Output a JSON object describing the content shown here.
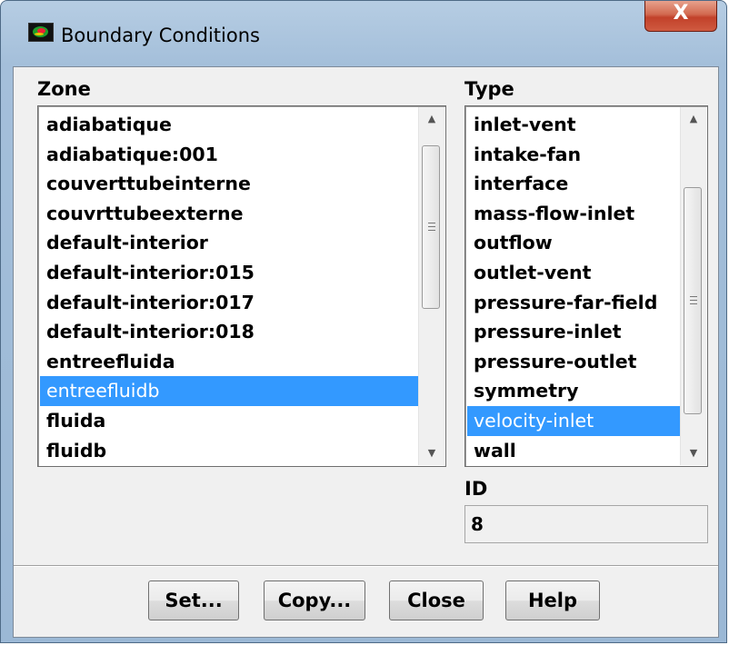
{
  "window": {
    "title": "Boundary Conditions",
    "close_glyph": "X",
    "app_icon": "fluent-app-icon"
  },
  "zone": {
    "label": "Zone",
    "items": [
      "adiabatique",
      "adiabatique:001",
      "couverttubeinterne",
      "couvrttubeexterne",
      "default-interior",
      "default-interior:015",
      "default-interior:017",
      "default-interior:018",
      "entreefluida",
      "entreefluidb",
      "fluida",
      "fluidb"
    ],
    "selected": "entreefluidb"
  },
  "type": {
    "label": "Type",
    "items": [
      "inlet-vent",
      "intake-fan",
      "interface",
      "mass-flow-inlet",
      "outflow",
      "outlet-vent",
      "pressure-far-field",
      "pressure-inlet",
      "pressure-outlet",
      "symmetry",
      "velocity-inlet",
      "wall"
    ],
    "selected": "velocity-inlet"
  },
  "id": {
    "label": "ID",
    "value": "8"
  },
  "buttons": {
    "set": "Set...",
    "copy": "Copy...",
    "close": "Close",
    "help": "Help"
  },
  "scroll_glyphs": {
    "up": "▲",
    "down": "▼"
  },
  "colors": {
    "selection": "#3399ff",
    "close_button": "#c9472e",
    "window_frame": "#a9c3dd"
  }
}
